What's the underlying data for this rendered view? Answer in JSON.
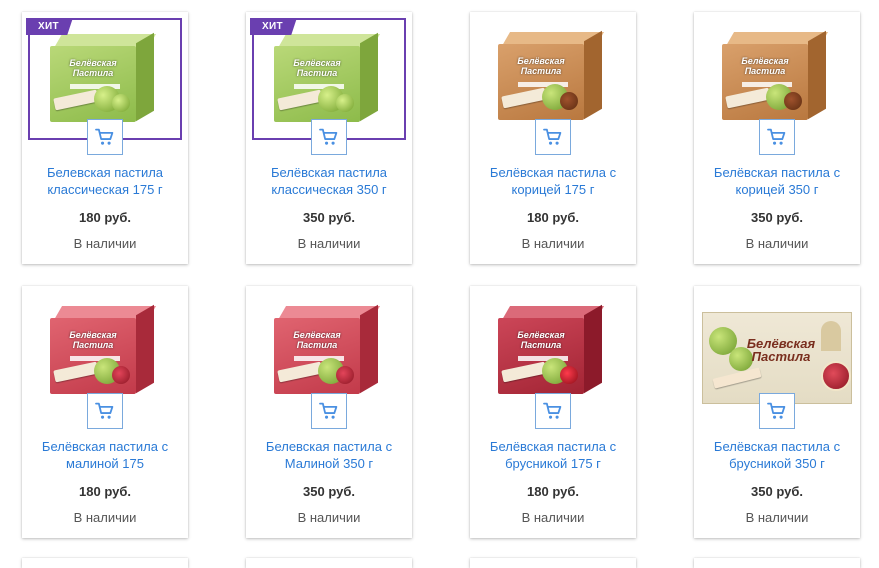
{
  "badges": {
    "hit": "ХИТ"
  },
  "icons": {
    "cart": "shopping-cart-icon"
  },
  "colors": {
    "accent": "#6a3fb0",
    "link": "#2a7ad6",
    "cart_border": "#7aa9dd"
  },
  "products": [
    {
      "name": "Белевская пастила классическая 175 г",
      "price": "180 руб.",
      "stock": "В наличии",
      "badge": true,
      "selected": true,
      "flavor": "apple"
    },
    {
      "name": "Белёвская пастила классическая 350 г",
      "price": "350 руб.",
      "stock": "В наличии",
      "badge": true,
      "selected": true,
      "flavor": "apple"
    },
    {
      "name": "Белёвская пастила с корицей 175 г",
      "price": "180 руб.",
      "stock": "В наличии",
      "badge": false,
      "selected": false,
      "flavor": "cinnamon"
    },
    {
      "name": "Белёвская пастила с корицей 350 г",
      "price": "350 руб.",
      "stock": "В наличии",
      "badge": false,
      "selected": false,
      "flavor": "cinnamon"
    },
    {
      "name": "Белёвская пастила с малиной 175",
      "price": "180 руб.",
      "stock": "В наличии",
      "badge": false,
      "selected": false,
      "flavor": "raspberry"
    },
    {
      "name": "Белевская пастила с Малиной 350 г",
      "price": "350 руб.",
      "stock": "В наличии",
      "badge": false,
      "selected": false,
      "flavor": "raspberry"
    },
    {
      "name": "Белёвская пастила с брусникой 175 г",
      "price": "180 руб.",
      "stock": "В наличии",
      "badge": false,
      "selected": false,
      "flavor": "lingonberry"
    },
    {
      "name": "Белёвская пастила с брусникой 350 г",
      "price": "350 руб.",
      "stock": "В наличии",
      "badge": false,
      "selected": false,
      "flavor": "banner"
    }
  ],
  "box_label": "Белёвская Пастила",
  "banner_title": "Белёвская Пастила"
}
